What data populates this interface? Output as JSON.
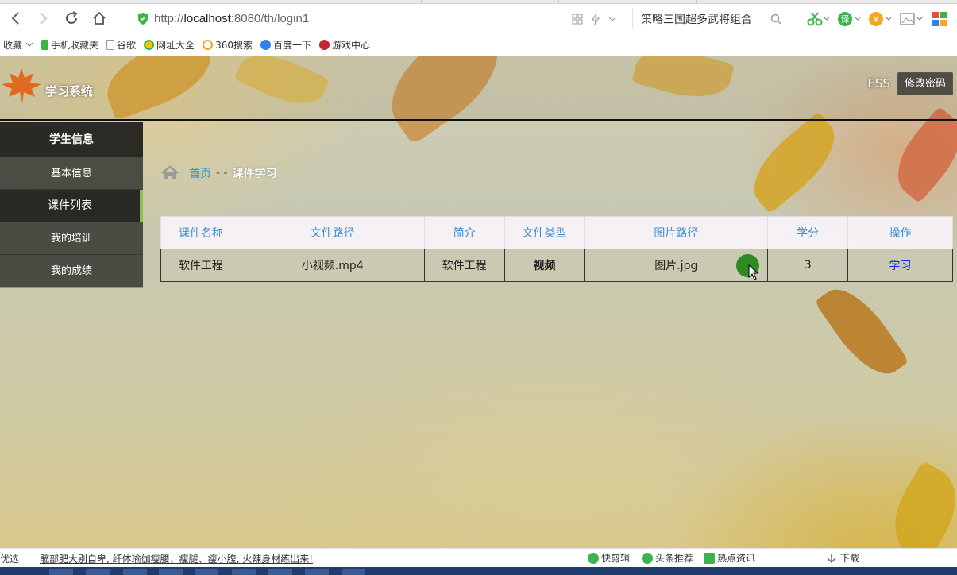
{
  "browser": {
    "url_prefix": "http://",
    "url_host": "localhost",
    "url_rest": ":8080/th/login1",
    "search_text": "策略三国超多武将组合",
    "bookmarks": [
      "收藏",
      "手机收藏夹",
      "谷歌",
      "网址大全",
      "360搜索",
      "百度一下",
      "游戏中心"
    ]
  },
  "header": {
    "brand": "学习系统",
    "user": "ESS",
    "change_password": "修改密码"
  },
  "sidebar": {
    "title": "学生信息",
    "items": [
      {
        "label": "基本信息"
      },
      {
        "label": "课件列表"
      },
      {
        "label": "我的培训"
      },
      {
        "label": "我的成绩"
      }
    ]
  },
  "breadcrumb": {
    "home": "首页",
    "separator": "- -",
    "current": "课件学习"
  },
  "table": {
    "headers": [
      "课件名称",
      "文件路径",
      "简介",
      "文件类型",
      "图片路径",
      "学分",
      "操作"
    ],
    "rows": [
      [
        "软件工程",
        "小视频.mp4",
        "软件工程",
        "视频",
        "图片.jpg",
        "3",
        "学习"
      ]
    ]
  },
  "statusbar": {
    "left": "优选",
    "news": "髋部肥大别自卑, 纤体瑜伽瘦腰、瘦腿、瘦小腹, 火辣身材练出来!",
    "tools": [
      "快剪辑",
      "头条推荐",
      "热点资讯",
      "下载"
    ]
  },
  "colors": {
    "link_blue": "#3a8fd0",
    "action_blue": "#1a2cf0",
    "active_accent": "#8bc34a"
  }
}
